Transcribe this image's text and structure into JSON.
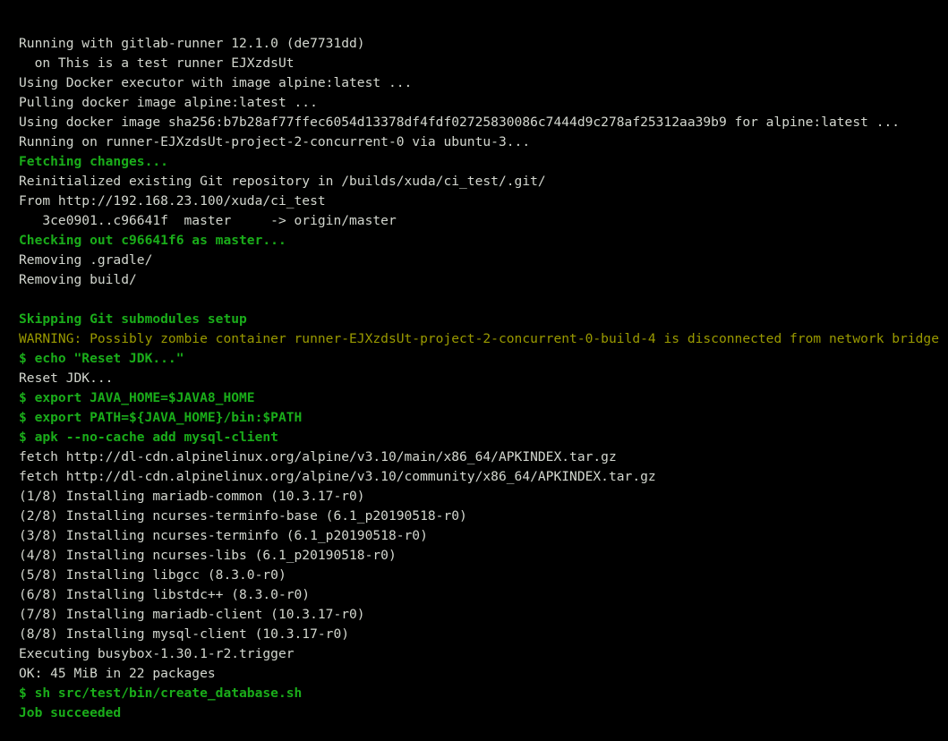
{
  "terminal": {
    "title": "GitLab CI job log",
    "background_color": "#000000",
    "default_text_color": "#d3d7cf",
    "accent_success_color": "#1aad1a",
    "warning_color": "#9a9a00",
    "font_size_px": 14.6,
    "line_height_px": 22,
    "runner_version": "12.1.0",
    "runner_revision": "de7731dd",
    "runner_name": "This is a test runner EJXzdsUt",
    "runner_token": "EJXzdsUt",
    "executor": "Docker",
    "docker_image": "alpine:latest",
    "image_digest": "sha256:b7b28af77ffec6054d13378df4fdf02725830086c7444d9c278af25312aa39b9",
    "host": "ubuntu-3",
    "container_name": "runner-EJXzdsUt-project-2-concurrent-0-build-4",
    "repository_url": "http://192.168.23.100/xuda/ci_test",
    "build_path": "/builds/xuda/ci_test/.git",
    "branch": "master",
    "commit_range": "3ce0901..c96641f",
    "checkout_sha": "c96641f6",
    "packages_installed": 8,
    "disk_usage": "45 MiB",
    "total_packages": 22,
    "final_status": "Job succeeded",
    "lines": [
      {
        "text": "Running with gitlab-runner 12.1.0 (de7731dd)",
        "style": "plain"
      },
      {
        "text": "  on This is a test runner EJXzdsUt",
        "style": "plain"
      },
      {
        "text": "Using Docker executor with image alpine:latest ...",
        "style": "plain"
      },
      {
        "text": "Pulling docker image alpine:latest ...",
        "style": "plain"
      },
      {
        "text": "Using docker image sha256:b7b28af77ffec6054d13378df4fdf02725830086c7444d9c278af25312aa39b9 for alpine:latest ...",
        "style": "plain"
      },
      {
        "text": "Running on runner-EJXzdsUt-project-2-concurrent-0 via ubuntu-3...",
        "style": "plain"
      },
      {
        "text": "Fetching changes...",
        "style": "green"
      },
      {
        "text": "Reinitialized existing Git repository in /builds/xuda/ci_test/.git/",
        "style": "plain"
      },
      {
        "text": "From http://192.168.23.100/xuda/ci_test",
        "style": "plain"
      },
      {
        "text": "   3ce0901..c96641f  master     -> origin/master",
        "style": "plain"
      },
      {
        "text": "Checking out c96641f6 as master...",
        "style": "green"
      },
      {
        "text": "Removing .gradle/",
        "style": "plain"
      },
      {
        "text": "Removing build/",
        "style": "plain"
      },
      {
        "text": "",
        "style": "blank"
      },
      {
        "text": "Skipping Git submodules setup",
        "style": "green"
      },
      {
        "text": "WARNING: Possibly zombie container runner-EJXzdsUt-project-2-concurrent-0-build-4 is disconnected from network bridge",
        "style": "yellow"
      },
      {
        "text": "$ echo \"Reset JDK...\"",
        "style": "green"
      },
      {
        "text": "Reset JDK...",
        "style": "plain"
      },
      {
        "text": "$ export JAVA_HOME=$JAVA8_HOME",
        "style": "green"
      },
      {
        "text": "$ export PATH=${JAVA_HOME}/bin:$PATH",
        "style": "green"
      },
      {
        "text": "$ apk --no-cache add mysql-client",
        "style": "green"
      },
      {
        "text": "fetch http://dl-cdn.alpinelinux.org/alpine/v3.10/main/x86_64/APKINDEX.tar.gz",
        "style": "plain"
      },
      {
        "text": "fetch http://dl-cdn.alpinelinux.org/alpine/v3.10/community/x86_64/APKINDEX.tar.gz",
        "style": "plain"
      },
      {
        "text": "(1/8) Installing mariadb-common (10.3.17-r0)",
        "style": "plain"
      },
      {
        "text": "(2/8) Installing ncurses-terminfo-base (6.1_p20190518-r0)",
        "style": "plain"
      },
      {
        "text": "(3/8) Installing ncurses-terminfo (6.1_p20190518-r0)",
        "style": "plain"
      },
      {
        "text": "(4/8) Installing ncurses-libs (6.1_p20190518-r0)",
        "style": "plain"
      },
      {
        "text": "(5/8) Installing libgcc (8.3.0-r0)",
        "style": "plain"
      },
      {
        "text": "(6/8) Installing libstdc++ (8.3.0-r0)",
        "style": "plain"
      },
      {
        "text": "(7/8) Installing mariadb-client (10.3.17-r0)",
        "style": "plain"
      },
      {
        "text": "(8/8) Installing mysql-client (10.3.17-r0)",
        "style": "plain"
      },
      {
        "text": "Executing busybox-1.30.1-r2.trigger",
        "style": "plain"
      },
      {
        "text": "OK: 45 MiB in 22 packages",
        "style": "plain"
      },
      {
        "text": "$ sh src/test/bin/create_database.sh",
        "style": "green"
      },
      {
        "text": "Job succeeded",
        "style": "green"
      }
    ]
  }
}
